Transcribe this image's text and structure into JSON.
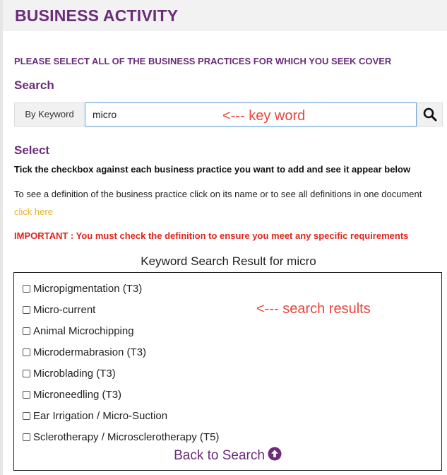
{
  "header": {
    "title": "BUSINESS ACTIVITY"
  },
  "instruction": "PLEASE SELECT ALL OF THE BUSINESS PRACTICES FOR WHICH YOU SEEK COVER",
  "search": {
    "heading": "Search",
    "keyword_label": "By Keyword",
    "value": "micro",
    "annotation": "<--- key word",
    "icon": "search-icon"
  },
  "select": {
    "heading": "Select",
    "tick_instruction": "Tick the checkbox against each business practice you want to add and see it appear below",
    "definition_text": "To see a definition of the business practice click on its name or to see all definitions in one document",
    "definition_link": "click here",
    "important": "IMPORTANT : You must check the definition to ensure you meet any specific requirements"
  },
  "results": {
    "title": "Keyword Search Result for micro",
    "annotation": "<--- search results",
    "items": [
      {
        "label": "Micropigmentation (T3)",
        "checked": false
      },
      {
        "label": "Micro-current",
        "checked": false
      },
      {
        "label": "Animal Microchipping",
        "checked": false
      },
      {
        "label": "Microdermabrasion (T3)",
        "checked": false
      },
      {
        "label": "Microblading (T3)",
        "checked": false
      },
      {
        "label": "Microneedling (T3)",
        "checked": false
      },
      {
        "label": "Ear Irrigation / Micro-Suction",
        "checked": false
      },
      {
        "label": "Sclerotherapy / Microsclerotherapy (T5)",
        "checked": false
      }
    ],
    "back_label": "Back to Search",
    "back_icon": "arrow-up-circle-icon"
  },
  "colors": {
    "brand_purple": "#6b2c7a",
    "annotation_red": "#e8453c",
    "important_red": "#e2231a",
    "link_yellow": "#e8b422"
  }
}
